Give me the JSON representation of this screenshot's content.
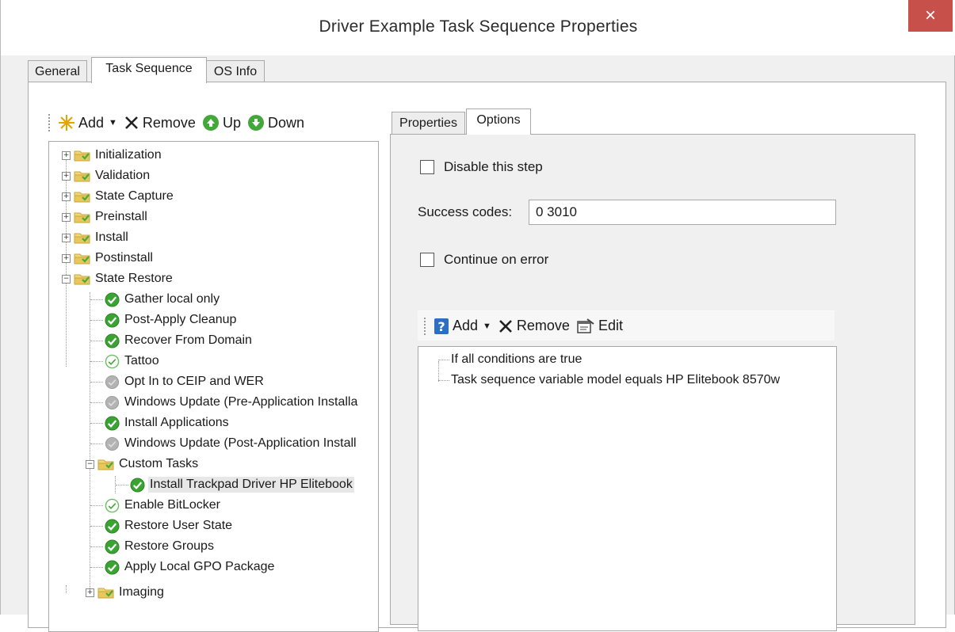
{
  "window": {
    "title": "Driver Example Task Sequence Properties",
    "close_glyph": "×"
  },
  "outer_tabs": [
    {
      "label": "General",
      "active": false
    },
    {
      "label": "Task Sequence",
      "active": true
    },
    {
      "label": "OS Info",
      "active": false
    }
  ],
  "tree_toolbar": {
    "add_label": "Add",
    "remove_label": "Remove",
    "up_label": "Up",
    "down_label": "Down"
  },
  "tree": {
    "groups": [
      {
        "label": "Initialization",
        "expander": "+"
      },
      {
        "label": "Validation",
        "expander": "+"
      },
      {
        "label": "State Capture",
        "expander": "+"
      },
      {
        "label": "Preinstall",
        "expander": "+"
      },
      {
        "label": "Install",
        "expander": "+"
      },
      {
        "label": "Postinstall",
        "expander": "+"
      },
      {
        "label": "State Restore",
        "expander": "−"
      }
    ],
    "state_restore_items": [
      {
        "label": "Gather local only",
        "status": "enabled"
      },
      {
        "label": "Post-Apply Cleanup",
        "status": "enabled"
      },
      {
        "label": "Recover From Domain",
        "status": "enabled"
      },
      {
        "label": "Tattoo",
        "status": "conditional"
      },
      {
        "label": "Opt In to CEIP and WER",
        "status": "disabled"
      },
      {
        "label": "Windows Update (Pre-Application Installa",
        "status": "disabled"
      },
      {
        "label": "Install Applications",
        "status": "enabled"
      },
      {
        "label": "Windows Update (Post-Application Install",
        "status": "disabled"
      }
    ],
    "custom_tasks": {
      "label": "Custom Tasks",
      "expander": "−",
      "child": {
        "label": "Install Trackpad Driver HP Elitebook",
        "status": "enabled",
        "selected": true
      }
    },
    "state_restore_items_after": [
      {
        "label": "Enable BitLocker",
        "status": "conditional"
      },
      {
        "label": "Restore User State",
        "status": "enabled"
      },
      {
        "label": "Restore Groups",
        "status": "enabled"
      },
      {
        "label": "Apply Local GPO Package",
        "status": "enabled"
      }
    ],
    "imaging": {
      "label": "Imaging",
      "expander": "+"
    }
  },
  "inner_tabs": [
    {
      "label": "Properties",
      "active": false
    },
    {
      "label": "Options",
      "active": true
    }
  ],
  "options": {
    "disable_label": "Disable this step",
    "success_codes_label": "Success codes:",
    "success_codes_value": "0 3010",
    "continue_label": "Continue on error"
  },
  "cond_toolbar": {
    "add_label": "Add",
    "remove_label": "Remove",
    "edit_label": "Edit"
  },
  "conditions": [
    "If all conditions are true",
    "Task sequence variable model equals HP Elitebook 8570w"
  ],
  "colors": {
    "close_red": "#c7504a",
    "status_green": "#3aa332",
    "status_gray": "#a6a6a6",
    "folder_yellow": "#e8c85a"
  }
}
